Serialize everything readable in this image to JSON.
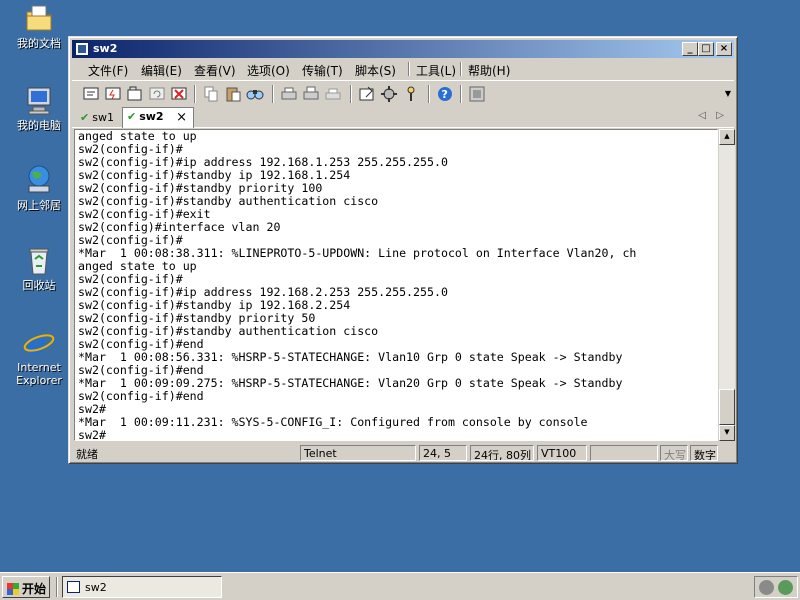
{
  "desktop": {
    "icons": [
      {
        "label": "我的文档",
        "icon": "my-documents-icon"
      },
      {
        "label": "我的电脑",
        "icon": "my-computer-icon"
      },
      {
        "label": "网上邻居",
        "icon": "network-places-icon"
      },
      {
        "label": "回收站",
        "icon": "recycle-bin-icon"
      },
      {
        "label": "Internet Explorer",
        "icon": "internet-explorer-icon"
      }
    ]
  },
  "window": {
    "title": "sw2",
    "controls": {
      "minimize": "_",
      "maximize": "□",
      "close": "×"
    },
    "menu": [
      "文件(F)",
      "编辑(E)",
      "查看(V)",
      "选项(O)",
      "传输(T)",
      "脚本(S)",
      "工具(L)",
      "帮助(H)"
    ],
    "toolbar_icons": [
      "connect-icon",
      "quick-connect-icon",
      "connect-in-tab-icon",
      "reconnect-icon",
      "disconnect-icon",
      "copy-icon",
      "paste-icon",
      "find-icon",
      "print-icon",
      "print-selection-icon",
      "print-setup-icon",
      "session-options-icon",
      "global-options-icon",
      "keymap-icon",
      "help-icon",
      "about-icon"
    ],
    "tabs": [
      {
        "label": "sw1",
        "active": false
      },
      {
        "label": "sw2",
        "active": true,
        "close": "×"
      }
    ],
    "tab_nav": {
      "left": "◁",
      "right": "▷"
    },
    "terminal_lines": [
      "anged state to up",
      "sw2(config-if)#",
      "sw2(config-if)#ip address 192.168.1.253 255.255.255.0",
      "sw2(config-if)#standby ip 192.168.1.254",
      "sw2(config-if)#standby priority 100",
      "sw2(config-if)#standby authentication cisco",
      "sw2(config-if)#exit",
      "sw2(config)#interface vlan 20",
      "sw2(config-if)#",
      "*Mar  1 00:08:38.311: %LINEPROTO-5-UPDOWN: Line protocol on Interface Vlan20, ch",
      "anged state to up",
      "sw2(config-if)#",
      "sw2(config-if)#ip address 192.168.2.253 255.255.255.0",
      "sw2(config-if)#standby ip 192.168.2.254",
      "sw2(config-if)#standby priority 50",
      "sw2(config-if)#standby authentication cisco",
      "sw2(config-if)#end",
      "*Mar  1 00:08:56.331: %HSRP-5-STATECHANGE: Vlan10 Grp 0 state Speak -> Standby",
      "sw2(config-if)#end",
      "*Mar  1 00:09:09.275: %HSRP-5-STATECHANGE: Vlan20 Grp 0 state Speak -> Standby",
      "sw2(config-if)#end",
      "sw2#",
      "*Mar  1 00:09:11.231: %SYS-5-CONFIG_I: Configured from console by console",
      "sw2#"
    ],
    "status": {
      "ready": "就绪",
      "protocol": "Telnet",
      "cursor": "24,  5",
      "size": "24行, 80列",
      "emulation": "VT100",
      "caps": "大写",
      "num": "数字"
    }
  },
  "taskbar": {
    "start_label": "开始",
    "task_label": "sw2"
  },
  "colors": {
    "desktop": "#3a6ea5",
    "title_active_start": "#0a246a",
    "title_active_end": "#a6caf0",
    "chrome": "#d4d0c8"
  }
}
